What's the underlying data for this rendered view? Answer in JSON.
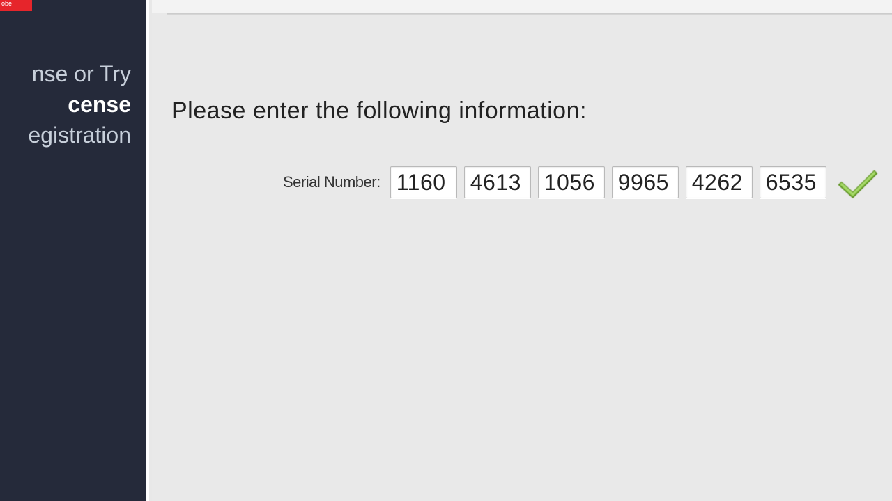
{
  "brand": {
    "logo_text": "obe"
  },
  "sidebar": {
    "items": [
      {
        "label": "nse or Try",
        "active": false
      },
      {
        "label": "cense",
        "active": true
      },
      {
        "label": "egistration",
        "active": false
      }
    ]
  },
  "main": {
    "prompt": "Please enter the following information:",
    "serial_label": "Serial Number:",
    "serial_parts": [
      "1160",
      "4613",
      "1056",
      "9965",
      "4262",
      "6535"
    ],
    "validation_state": "valid"
  },
  "colors": {
    "sidebar_bg": "#252a3a",
    "brand_red": "#e6252b",
    "check_green": "#7fc241"
  }
}
